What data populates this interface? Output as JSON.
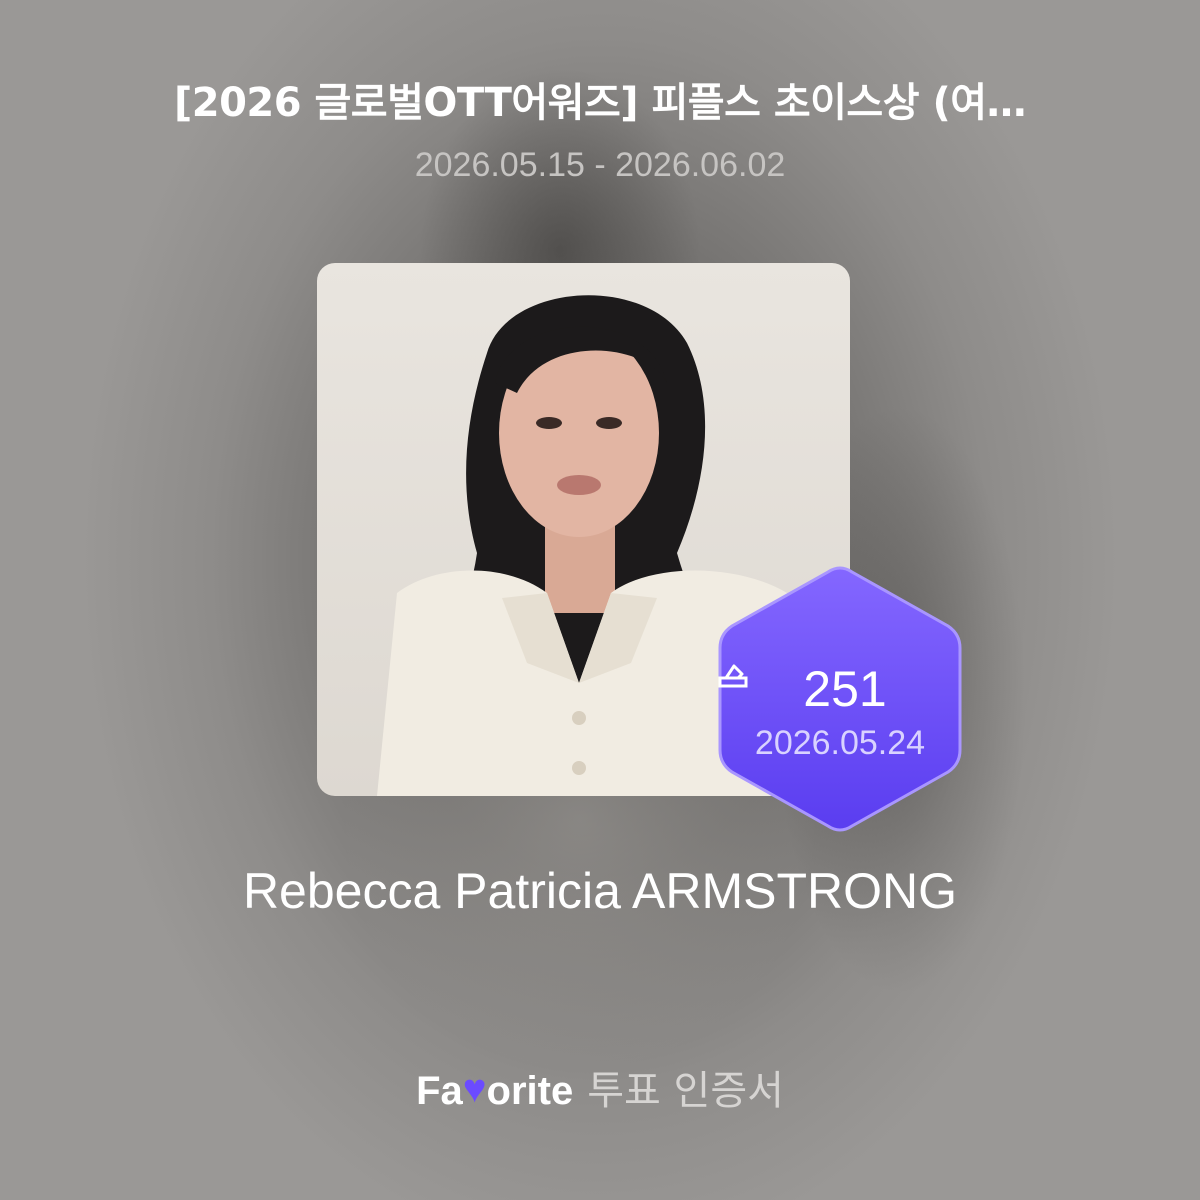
{
  "header": {
    "title": "[2026 글로벌OTT어워즈] 피플스 초이스상 (여…",
    "date_range": "2026.05.15 - 2026.06.02"
  },
  "nominee": {
    "photo_icon": "portrait-photo",
    "name": "Rebecca Patricia ARMSTRONG"
  },
  "vote_badge": {
    "icon": "ballot-icon",
    "count": "251",
    "date": "2026.05.24",
    "color": "#6b4bff"
  },
  "footer": {
    "brand_prefix": "Fa",
    "brand_heart": "♥",
    "brand_suffix": "orite",
    "certificate_label": "투표 인증서",
    "brand_color": "#6b4bff"
  }
}
